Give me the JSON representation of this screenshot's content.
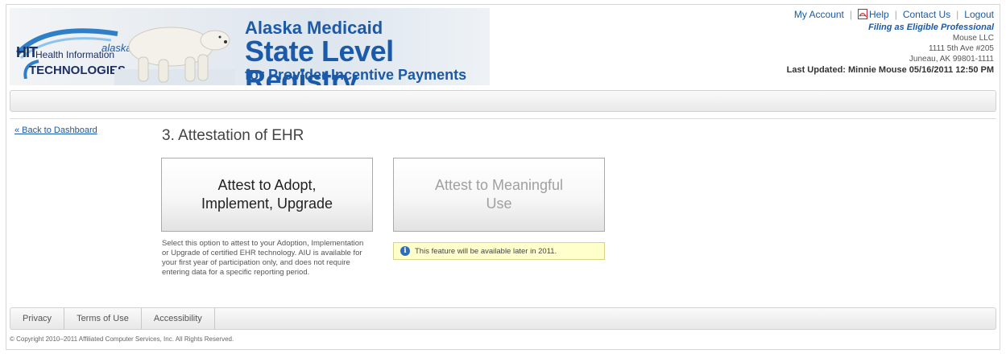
{
  "header": {
    "logo": {
      "hit": "HIT",
      "health": "Health Information",
      "state": "alaska",
      "tech": "TECHNOLOGIES"
    },
    "title_line1": "Alaska Medicaid",
    "title_line2": "State Level Registry",
    "title_line3": "for Provider Incentive Payments"
  },
  "top_links": {
    "my_account": "My Account",
    "help": "Help",
    "contact_us": "Contact Us",
    "logout": "Logout"
  },
  "account": {
    "filing_as": "Filing as Eligible Professional",
    "name": "Mouse LLC",
    "address1": "1111 5th Ave #205",
    "address2": "Juneau, AK 99801-1111",
    "last_updated": "Last Updated: Minnie Mouse 05/16/2011 12:50 PM"
  },
  "main": {
    "back_link": "« Back to Dashboard",
    "title": "3. Attestation of EHR",
    "tile_adopt": {
      "line1": "Attest to Adopt,",
      "line2": "Implement, Upgrade"
    },
    "tile_mu": {
      "line1": "Attest to Meaningful",
      "line2": "Use"
    },
    "adopt_description": "Select this option to attest to your Adoption, Implementation or Upgrade of certified EHR technology. AIU is available for your first year of participation only, and does not require entering data for a specific reporting period.",
    "mu_notice": "This feature will be available later in 2011."
  },
  "footer": {
    "links": [
      "Privacy",
      "Terms of Use",
      "Accessibility"
    ],
    "copyright": "© Copyright 2010–2011 Affiliated Computer Services, Inc. All Rights Reserved."
  },
  "colors": {
    "brand_blue": "#1b5aa8",
    "notice_bg": "#ffffcc"
  },
  "icons": {
    "help": "pdf-icon",
    "notice": "info-icon"
  }
}
